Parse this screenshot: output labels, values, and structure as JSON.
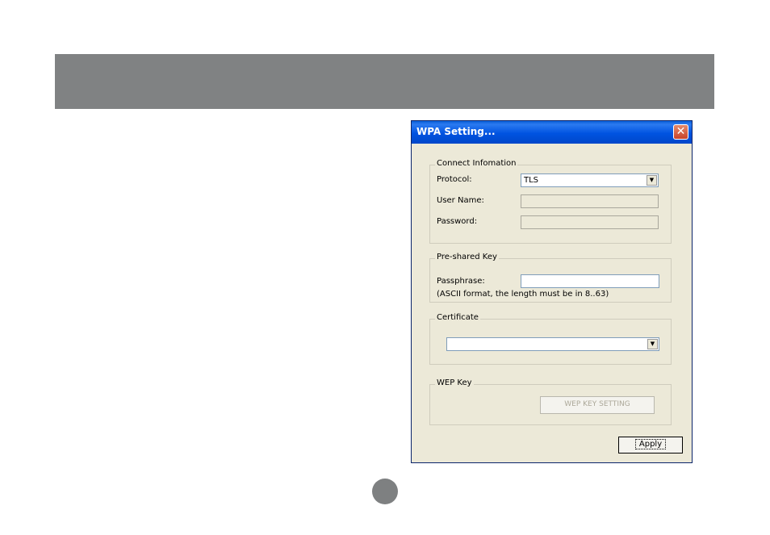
{
  "dialog": {
    "title": "WPA Setting...",
    "close_glyph": "✕",
    "connect": {
      "legend": "Connect Infomation",
      "protocol_label": "Protocol:",
      "protocol_value": "TLS",
      "username_label": "User Name:",
      "username_value": "",
      "password_label": "Password:",
      "password_value": ""
    },
    "psk": {
      "legend": "Pre-shared Key",
      "passphrase_label": "Passphrase:",
      "passphrase_value": "",
      "hint": "(ASCII format, the length must be in 8..63)"
    },
    "certificate": {
      "legend": "Certificate",
      "value": ""
    },
    "wep": {
      "legend": "WEP Key",
      "button_label": "WEP KEY SETTING"
    },
    "apply_label": "Apply"
  }
}
